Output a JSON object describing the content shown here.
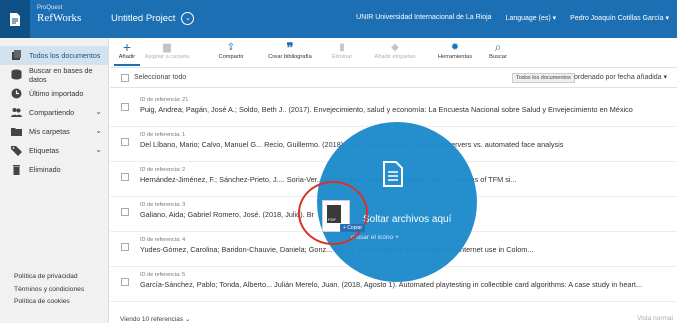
{
  "header": {
    "logo_small": "ProQuest",
    "logo_big": "RefWorks",
    "project": "Untitled Project",
    "institution": "UNIR Universidad Internacional de La Rioja",
    "language": "Language (es) ▾",
    "user": "Pedro Joaquín Cotillas García ▾"
  },
  "sidebar": {
    "items": [
      {
        "label": "Todos los documentos",
        "icon": "documents-icon",
        "active": true
      },
      {
        "label": "Buscar en bases de datos",
        "icon": "database-icon"
      },
      {
        "label": "Último importado",
        "icon": "clock-icon"
      },
      {
        "label": "Compartiendo",
        "icon": "users-icon",
        "chev": "⌄"
      },
      {
        "label": "Mis carpetas",
        "icon": "folder-icon",
        "chev": "⌄"
      },
      {
        "label": "Etiquetas",
        "icon": "tag-icon",
        "chev": "⌄"
      },
      {
        "label": "Eliminado",
        "icon": "trash-icon"
      }
    ],
    "footer": [
      "Política de privacidad",
      "Términos y condiciones",
      "Política de cookies"
    ]
  },
  "toolbar": {
    "buttons": [
      {
        "label": "Añadir",
        "icon": "+",
        "disabled": false
      },
      {
        "label": "Asignar a carpeta",
        "icon": "▆",
        "disabled": true
      },
      {
        "label": "Compartir",
        "icon": "⇪",
        "disabled": false
      },
      {
        "label": "Crear bibliografía",
        "icon": "❞",
        "disabled": false
      },
      {
        "label": "Eliminar",
        "icon": "▮",
        "disabled": true
      },
      {
        "label": "Añadir etiquetas",
        "icon": "◆",
        "disabled": true
      },
      {
        "label": "Herramientas",
        "icon": "✹",
        "disabled": false
      },
      {
        "label": "Buscar",
        "icon": "⌕",
        "disabled": false
      }
    ]
  },
  "selectbar": {
    "select_all": "Seleccionar todo",
    "filter": "Todos los documentos",
    "order": "ordenado por fecha añadida ▾"
  },
  "rows": [
    {
      "id": "ID de referencia: 21",
      "cite": "Puig, Andrea; Pagán, José A.; Soldo, Beth J.. (2017). Envejecimiento, salud y economía: La Encuesta Nacional sobre Salud y Envejecimiento en México"
    },
    {
      "id": "ID de referencia: 1",
      "cite": "Del Líbano, Mario; Calvo, Manuel G... Recio, Guillermo. (2018) ... een smiling faces: Human observers vs. automated face analysis"
    },
    {
      "id": "ID de referencia: 2",
      "cite": "Hernández-Jiménez, F.; Sánchez-Prieto, J.... Soria-Ver... o-mixing in pseudo-2D fluidized beds by means of TFM si..."
    },
    {
      "id": "ID de referencia: 3",
      "cite": "Galiano, Aida; Gabriel Romero, José. (2018, Julio). Br"
    },
    {
      "id": "ID de referencia: 4",
      "cite": "Yudes-Gómez, Carolina; Baridon-Chauvie, Daniela; Gonz... ulio 1). Cyberbullying and problematic internet use in Colom..."
    },
    {
      "id": "ID de referencia: 5",
      "cite": "García-Sánchez, Pablo; Tonda, Alberto... Julián Merelo, Juan. (2018, Agosto 1). Automated playtesting in collectible card algorithms: A case study in heart..."
    }
  ],
  "bottom": {
    "left": "Viendo 10 referencias ⌄",
    "right": "Vista normal"
  },
  "drop": {
    "title": "Soltar archivos aquí",
    "subtitle": "o usar el icono +",
    "copy_label": "+ Copiar",
    "file_label": "PDF",
    "file_name": "articulo.pdf"
  },
  "colors": {
    "primary": "#1c6fb2",
    "overlay": "#1e8acb",
    "highlight": "#d9322b"
  }
}
